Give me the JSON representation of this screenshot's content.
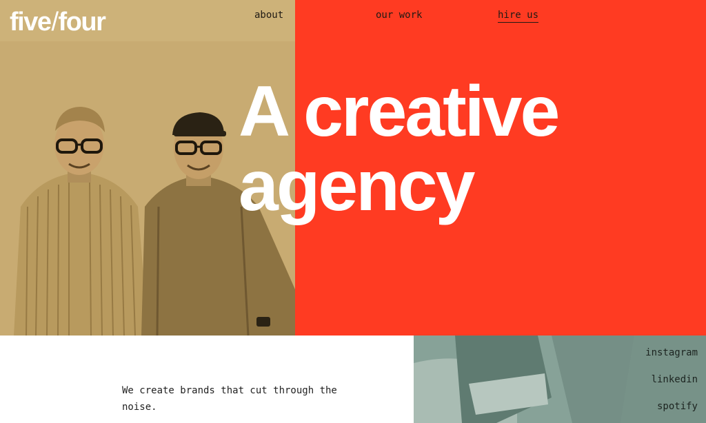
{
  "brand": {
    "logo_left": "five",
    "logo_slash": "/",
    "logo_right": "four"
  },
  "nav": {
    "about": "about",
    "our_work": "our work",
    "hire_us": "hire us"
  },
  "hero": {
    "headline_line1": "A creative",
    "headline_line2": "agency",
    "accent_color": "#ff3b22"
  },
  "intro": {
    "tagline": "We create brands that cut through the noise."
  },
  "social": {
    "instagram": "instagram",
    "linkedin": "linkedin",
    "spotify": "spotify"
  }
}
